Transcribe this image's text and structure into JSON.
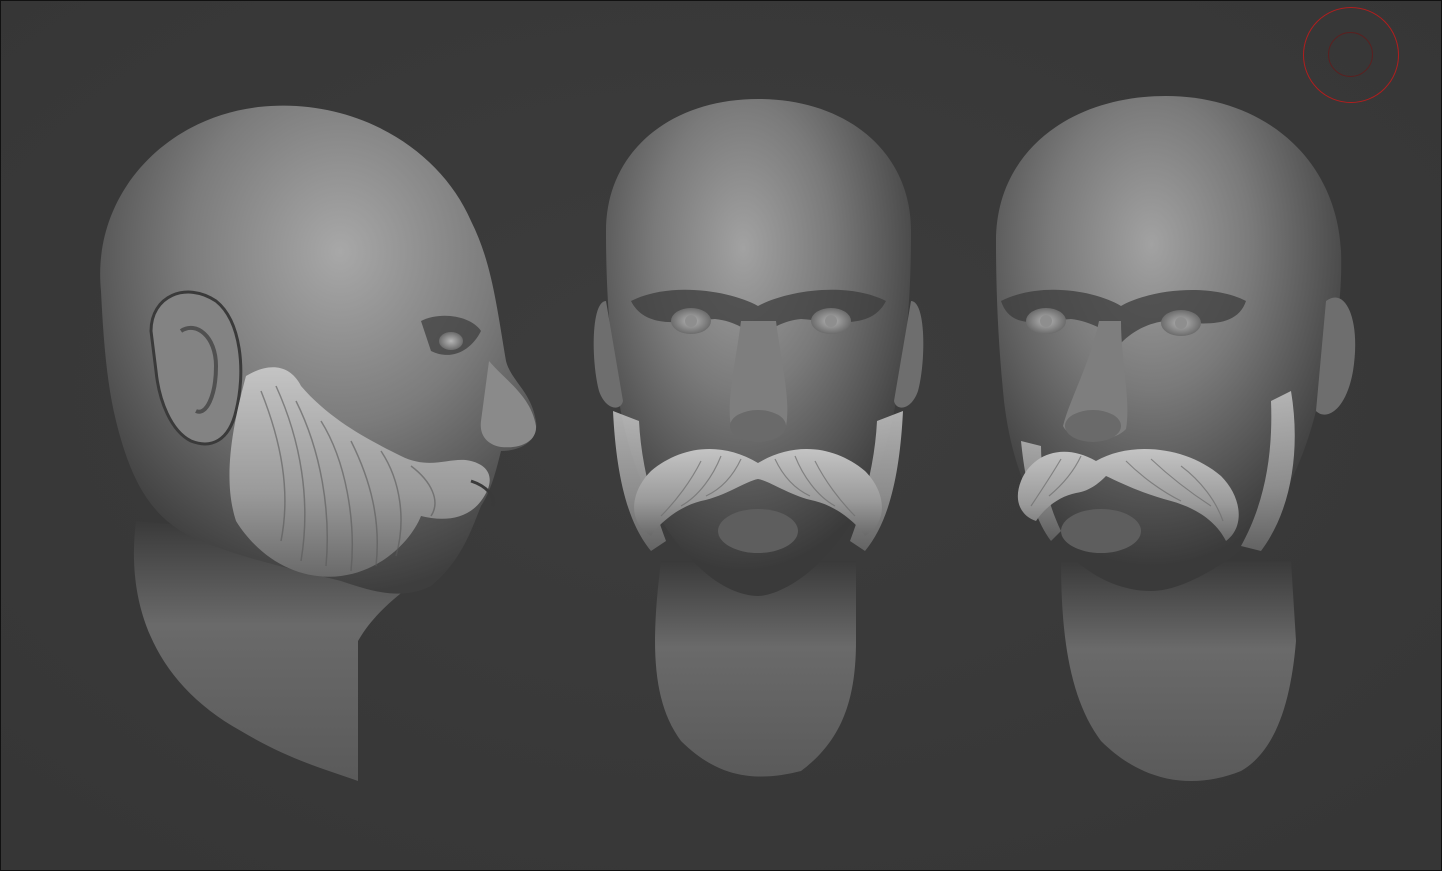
{
  "app": {
    "canvas_background": "#3a3a3a",
    "material_highlight": "#9a9a9a",
    "material_base": "#6d6d6d",
    "material_shadow": "#262626",
    "brush_cursor_color": "#b01e1e"
  },
  "viewport": {
    "models": [
      {
        "view": "side",
        "name": "head-side-view"
      },
      {
        "view": "front",
        "name": "head-front-view"
      },
      {
        "view": "three-quarter",
        "name": "head-three-quarter-view"
      }
    ],
    "icons": [
      "brush-cursor-icon"
    ]
  }
}
